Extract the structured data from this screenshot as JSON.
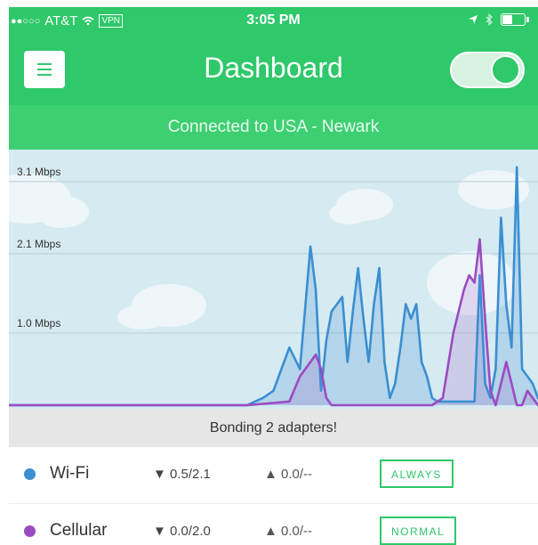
{
  "status_bar": {
    "signal": "●●○○○",
    "carrier": "AT&T",
    "wifi_icon": "wifi-icon",
    "vpn": "VPN",
    "time": "3:05 PM",
    "icons": [
      "location-arrow-icon",
      "bluetooth-icon",
      "battery-icon"
    ],
    "battery_level": 0.5
  },
  "header": {
    "title": "Dashboard",
    "menu_icon": "hamburger-icon",
    "toggle_on": true
  },
  "connection": {
    "text": "Connected to USA - Newark"
  },
  "colors": {
    "brand_green": "#2fc86a",
    "wifi": "#3a8fd1",
    "cellular": "#9b4bc1",
    "sky": "#d6eaf1"
  },
  "chart_data": {
    "type": "area",
    "ylabel": "",
    "ytick_labels": [
      "3.1 Mbps",
      "2.1 Mbps",
      "1.0 Mbps"
    ],
    "ytick_values": [
      3.1,
      2.1,
      1.0
    ],
    "ylim": [
      0,
      3.6
    ],
    "grid": true,
    "series": [
      {
        "name": "Wi-Fi",
        "color": "#3a8fd1",
        "x": [
          0,
          30,
          45,
          48,
          50,
          53,
          55,
          57,
          58,
          59,
          60,
          61,
          62,
          63,
          64,
          65,
          66,
          67,
          68,
          69,
          70,
          71,
          72,
          73,
          74,
          75,
          76,
          77,
          78,
          79,
          80,
          81,
          82,
          83,
          84,
          85,
          86,
          87,
          88,
          89,
          90,
          91,
          92,
          93,
          94,
          95,
          96,
          97,
          98,
          99,
          100
        ],
        "values": [
          0,
          0,
          0,
          0.1,
          0.2,
          0.8,
          0.5,
          2.2,
          1.6,
          0.2,
          0.9,
          1.3,
          1.4,
          1.5,
          0.6,
          1.3,
          1.9,
          1.2,
          0.6,
          1.4,
          1.9,
          0.6,
          0.1,
          0.3,
          0.8,
          1.4,
          1.2,
          1.4,
          0.6,
          0.4,
          0.1,
          0.05,
          0.05,
          0.05,
          0.05,
          0.05,
          0.05,
          0.05,
          0.05,
          1.8,
          0.3,
          0.1,
          0.5,
          2.6,
          1.4,
          0.8,
          3.3,
          0.5,
          0.4,
          0.3,
          0.1
        ]
      },
      {
        "name": "Cellular",
        "color": "#9b4bc1",
        "x": [
          0,
          5,
          10,
          30,
          45,
          53,
          55,
          58,
          59,
          60,
          61,
          62,
          63,
          64,
          65,
          75,
          80,
          82,
          84,
          86,
          87,
          88,
          89,
          90,
          91,
          92,
          93,
          94,
          95,
          96,
          97,
          98,
          99,
          100
        ],
        "values": [
          0,
          0,
          0,
          0,
          0,
          0.05,
          0.4,
          0.7,
          0.5,
          0.1,
          0,
          0,
          0,
          0,
          0,
          0,
          0,
          0.1,
          1.0,
          1.6,
          1.8,
          1.7,
          2.3,
          1.2,
          0.2,
          0,
          0.3,
          0.6,
          0.3,
          0,
          0,
          0.2,
          0.1,
          0
        ]
      }
    ]
  },
  "bonding": {
    "text": "Bonding 2 adapters!"
  },
  "adapters": [
    {
      "name": "Wi-Fi",
      "color": "#3a8fd1",
      "down": "▼ 0.5/2.1",
      "up": "▲ 0.0/--",
      "mode": "ALWAYS"
    },
    {
      "name": "Cellular",
      "color": "#9b4bc1",
      "down": "▼ 0.0/2.0",
      "up": "▲ 0.0/--",
      "mode": "NORMAL"
    }
  ]
}
